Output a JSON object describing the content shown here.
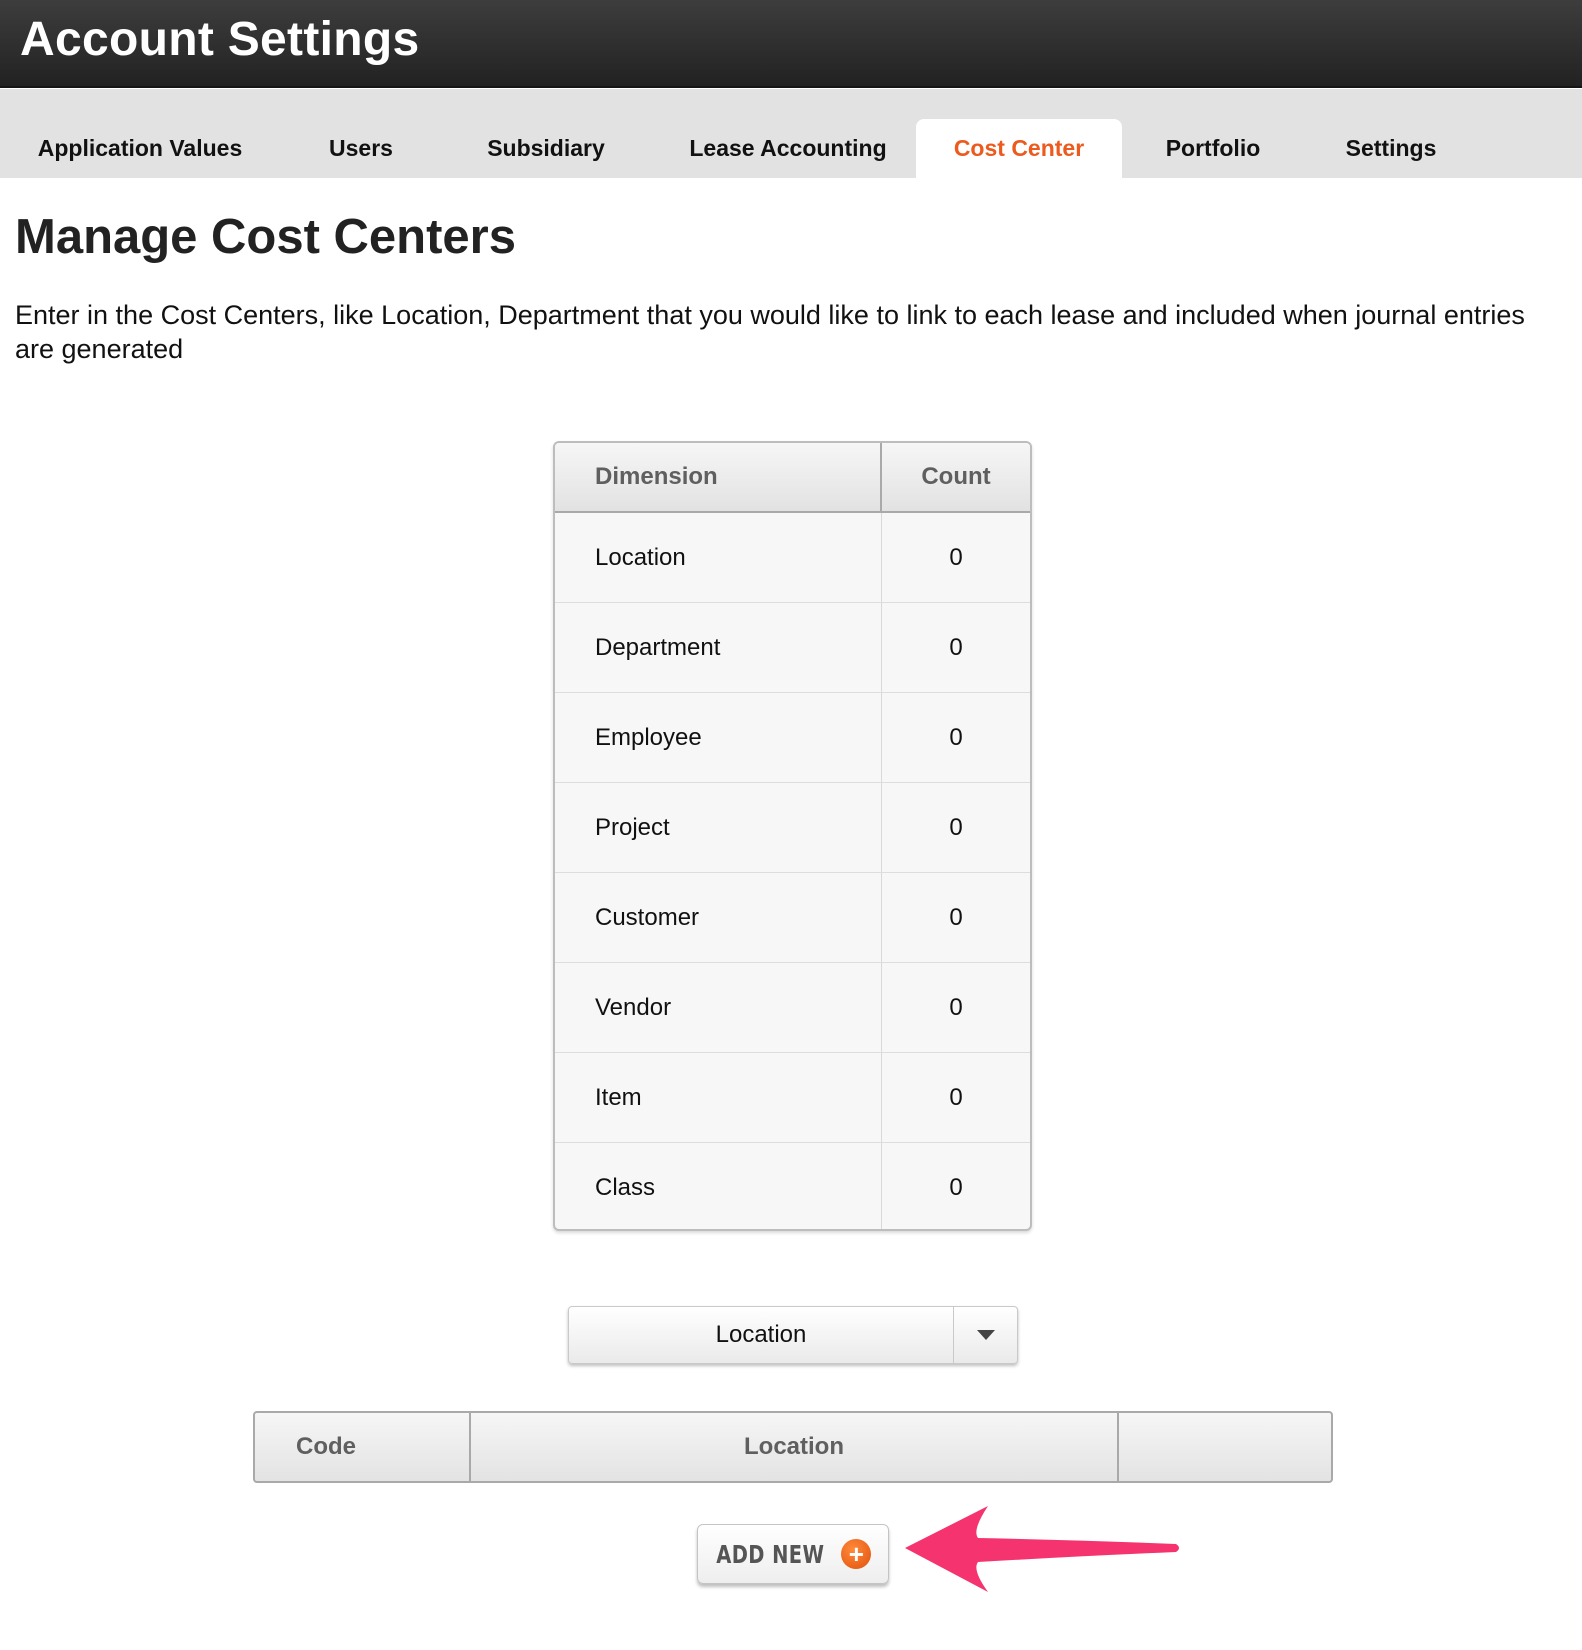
{
  "header": {
    "title": "Account Settings"
  },
  "tabs": [
    {
      "label": "Application Values",
      "active": false
    },
    {
      "label": "Users",
      "active": false
    },
    {
      "label": "Subsidiary",
      "active": false
    },
    {
      "label": "Lease Accounting",
      "active": false
    },
    {
      "label": "Cost Center",
      "active": true
    },
    {
      "label": "Portfolio",
      "active": false
    },
    {
      "label": "Settings",
      "active": false
    }
  ],
  "main": {
    "title": "Manage Cost Centers",
    "description": "Enter in the Cost Centers, like Location, Department that you would like to link to each lease and included when journal entries are generated"
  },
  "dimension_table": {
    "headers": [
      "Dimension",
      "Count"
    ],
    "rows": [
      {
        "dimension": "Location",
        "count": "0"
      },
      {
        "dimension": "Department",
        "count": "0"
      },
      {
        "dimension": "Employee",
        "count": "0"
      },
      {
        "dimension": "Project",
        "count": "0"
      },
      {
        "dimension": "Customer",
        "count": "0"
      },
      {
        "dimension": "Vendor",
        "count": "0"
      },
      {
        "dimension": "Item",
        "count": "0"
      },
      {
        "dimension": "Class",
        "count": "0"
      }
    ]
  },
  "dimension_select": {
    "selected": "Location",
    "icon": "chevron-down-icon"
  },
  "code_table": {
    "headers": [
      "Code",
      "Location",
      ""
    ]
  },
  "add_button": {
    "label": "ADD NEW",
    "icon": "plus-circle-icon"
  },
  "annotation": {
    "icon": "arrow-left-icon"
  },
  "colors": {
    "header_bg": "#2e2e2e",
    "tabbar_bg": "#e2e2e2",
    "active_tab_text": "#ec5a1e",
    "plus_icon": "#f26a21",
    "arrow": "#f4336f"
  }
}
